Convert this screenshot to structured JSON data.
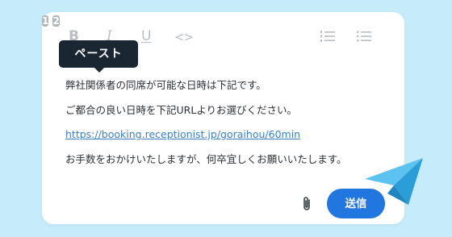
{
  "toolbar": {
    "bold": "B",
    "italic": "I",
    "underline": "U",
    "code": "<>",
    "heading1": "1",
    "heading2": "2",
    "ordered_list_icon": "ordered-list-icon",
    "bullet_list_icon": "bullet-list-icon"
  },
  "tooltip": {
    "label": "ペースト"
  },
  "message": {
    "line1": "弊社関係者の同席が可能な日時は下記です。",
    "line2": "ご都合の良い日時を下記URLよりお選びください。",
    "link": "https://booking.receptionist.jp/goraihou/60min",
    "line4": "お手数をおかけいたしますが、何卒宜しくお願いいたします。"
  },
  "actions": {
    "attach_icon": "paperclip-icon",
    "send_label": "送信"
  },
  "decoration": {
    "plane_icon": "paper-plane-icon"
  },
  "colors": {
    "background": "#c6ecfb",
    "card": "#ffffff",
    "tooltip": "#1b2633",
    "send_button": "#2176e0",
    "link": "#3a7fc8",
    "plane": "#2fa6e0"
  }
}
